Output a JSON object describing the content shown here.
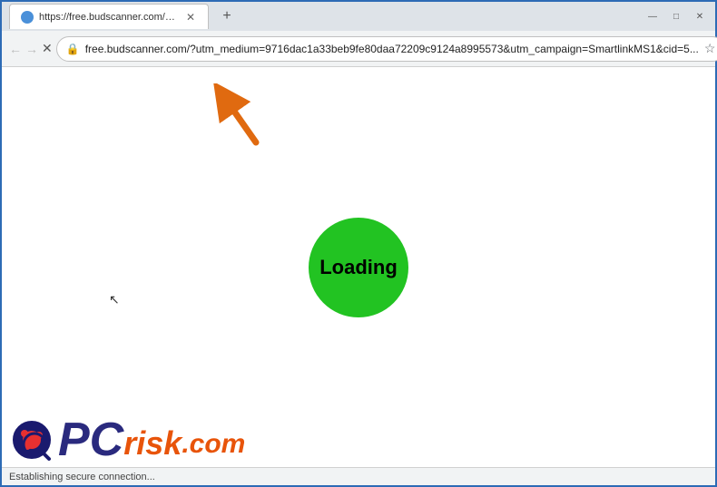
{
  "window": {
    "title": "https://free.budscanner.com/?ut...",
    "tab": {
      "title": "https://free.budscanner.com/?ut...",
      "favicon_color": "#4a90d9"
    }
  },
  "address_bar": {
    "url": "free.budscanner.com/?utm_medium=9716dac1a33beb9fe80daa72209c9124a8995573&utm_campaign=SmartlinkMS1&cid=5...",
    "loading": true
  },
  "nav": {
    "back_disabled": true,
    "forward_disabled": true
  },
  "page": {
    "loading_text": "Loading",
    "loading_bg_color": "#22c322"
  },
  "status": {
    "text": "Establishing secure connection..."
  },
  "buttons": {
    "new_tab": "+",
    "minimize": "—",
    "maximize": "□",
    "close": "✕",
    "back": "←",
    "forward": "→",
    "reload": "✕",
    "home": "⌂"
  },
  "watermark": {
    "pc_text": "PC",
    "risk_text": "risk",
    "dotcom_text": ".com"
  }
}
